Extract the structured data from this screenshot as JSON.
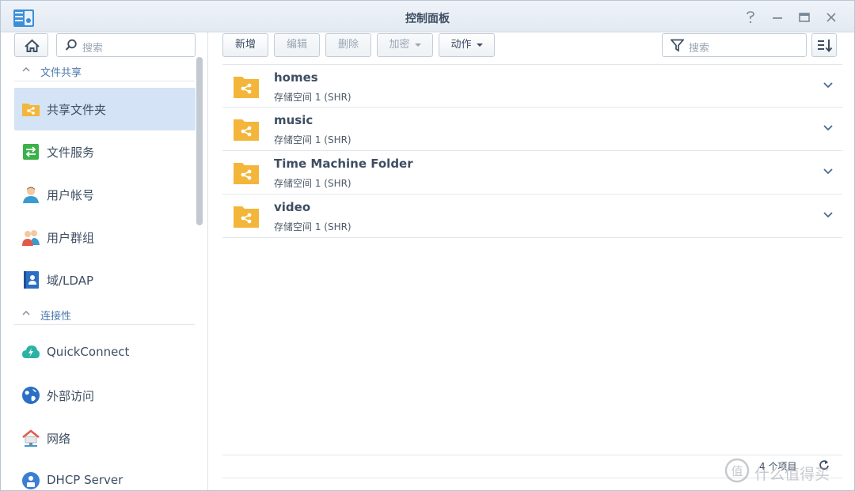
{
  "window": {
    "title": "控制面板"
  },
  "sidebar": {
    "search_placeholder": "搜索",
    "sections": [
      {
        "label": "文件共享"
      },
      {
        "label": "连接性"
      }
    ],
    "items": [
      {
        "label": "共享文件夹",
        "icon": "shared-folder-icon",
        "active": true
      },
      {
        "label": "文件服务",
        "icon": "file-services-icon"
      },
      {
        "label": "用户帐号",
        "icon": "user-icon"
      },
      {
        "label": "用户群组",
        "icon": "group-icon"
      },
      {
        "label": "域/LDAP",
        "icon": "domain-ldap-icon"
      },
      {
        "label": "QuickConnect",
        "icon": "quickconnect-icon"
      },
      {
        "label": "外部访问",
        "icon": "globe-icon"
      },
      {
        "label": "网络",
        "icon": "network-icon"
      },
      {
        "label": "DHCP Server",
        "icon": "dhcp-icon"
      }
    ]
  },
  "toolbar": {
    "create": "新增",
    "edit": "编辑",
    "delete": "删除",
    "encrypt": "加密",
    "action": "动作",
    "search_placeholder": "搜索"
  },
  "folders": [
    {
      "name": "homes",
      "location": "存储空间 1 (SHR)"
    },
    {
      "name": "music",
      "location": "存储空间 1 (SHR)"
    },
    {
      "name": "Time Machine Folder",
      "location": "存储空间 1 (SHR)"
    },
    {
      "name": "video",
      "location": "存储空间 1 (SHR)"
    }
  ],
  "footer": {
    "count": "4 个项目"
  },
  "watermark": {
    "text": "什么值得买",
    "logo": "值"
  },
  "colors": {
    "accent": "#4b78ad",
    "folder": "#f3b63a",
    "active_bg": "#d4e3f5"
  }
}
